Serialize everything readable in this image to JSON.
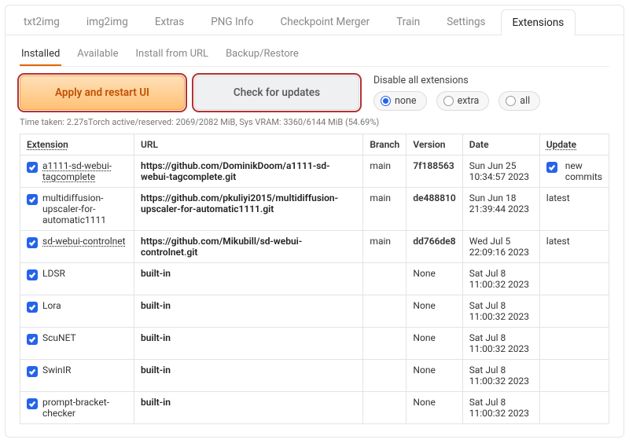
{
  "mainTabs": [
    "txt2img",
    "img2img",
    "Extras",
    "PNG Info",
    "Checkpoint Merger",
    "Train",
    "Settings",
    "Extensions"
  ],
  "mainActive": 7,
  "subTabs": [
    "Installed",
    "Available",
    "Install from URL",
    "Backup/Restore"
  ],
  "subActive": 0,
  "buttons": {
    "apply": "Apply and restart UI",
    "check": "Check for updates"
  },
  "disable": {
    "label": "Disable all extensions",
    "options": [
      "none",
      "extra",
      "all"
    ],
    "selected": 0
  },
  "timing": "Time taken: 2.27sTorch active/reserved: 2069/2082 MiB, Sys VRAM: 3360/6144 MiB (54.69%)",
  "columns": {
    "ext": "Extension",
    "url": "URL",
    "branch": "Branch",
    "version": "Version",
    "date": "Date",
    "update": "Update"
  },
  "rows": [
    {
      "name": "a1111-sd-webui-tagcomplete",
      "nameDeco": "a1111",
      "url": "https://github.com/DominikDoom/a1111-sd-webui-tagcomplete.git",
      "branch": "main",
      "version": "7f188563",
      "date": "Sun Jun 25 10:34:57 2023",
      "update": "new commits",
      "updateChk": true
    },
    {
      "name": "multidiffusion-upscaler-for-automatic1111",
      "url": "https://github.com/pkuliyi2015/multidiffusion-upscaler-for-automatic1111.git",
      "branch": "main",
      "version": "de488810",
      "date": "Sun Jun 18 21:39:44 2023",
      "update": "latest"
    },
    {
      "name": "sd-webui-controlnet",
      "nameDeco": "sd",
      "url": "https://github.com/Mikubill/sd-webui-controlnet.git",
      "branch": "main",
      "version": "dd766de8",
      "date": "Wed Jul 5 22:09:16 2023",
      "update": "latest"
    },
    {
      "name": "LDSR",
      "url": "built-in",
      "branch": "",
      "version": "None",
      "date": "Sat Jul 8 11:00:32 2023",
      "update": ""
    },
    {
      "name": "Lora",
      "url": "built-in",
      "branch": "",
      "version": "None",
      "date": "Sat Jul 8 11:00:32 2023",
      "update": ""
    },
    {
      "name": "ScuNET",
      "url": "built-in",
      "branch": "",
      "version": "None",
      "date": "Sat Jul 8 11:00:32 2023",
      "update": ""
    },
    {
      "name": "SwinIR",
      "url": "built-in",
      "branch": "",
      "version": "None",
      "date": "Sat Jul 8 11:00:32 2023",
      "update": ""
    },
    {
      "name": "prompt-bracket-checker",
      "url": "built-in",
      "branch": "",
      "version": "None",
      "date": "Sat Jul 8 11:00:32 2023",
      "update": ""
    }
  ]
}
